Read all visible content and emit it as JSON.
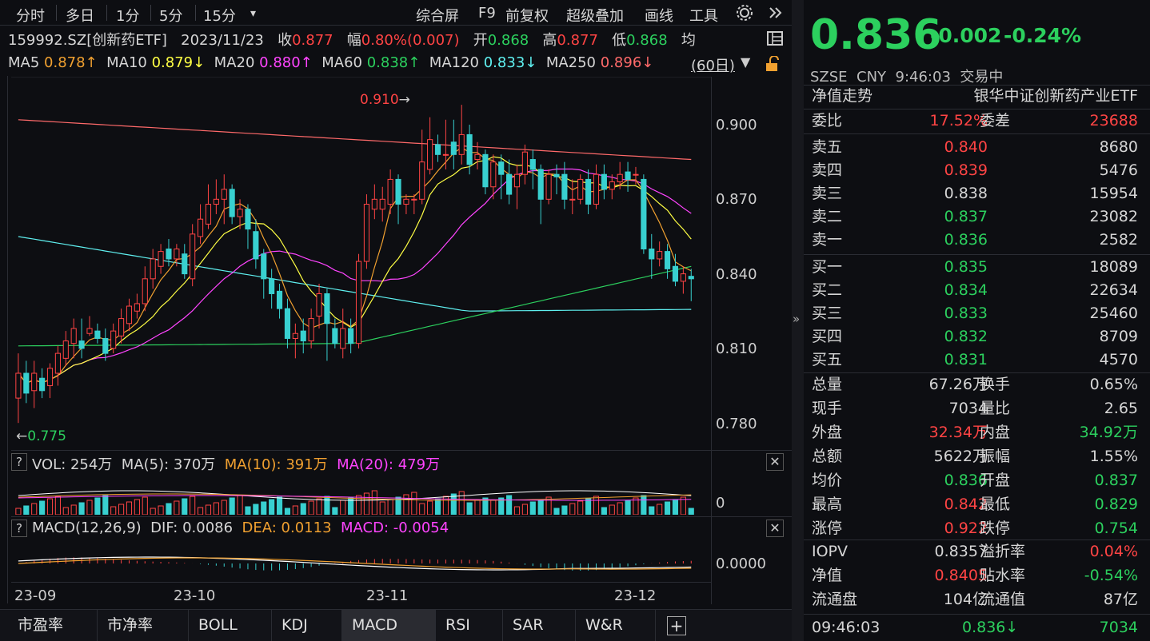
{
  "toolbar": {
    "left": [
      "分时",
      "多日",
      "1分",
      "5分",
      "15分"
    ],
    "dropdown": "▾",
    "right": [
      "综合屏",
      "F9",
      "前复权",
      "超级叠加",
      "画线",
      "工具"
    ]
  },
  "info": {
    "code": "159992.SZ[创新药ETF]",
    "date": "2023/11/23",
    "close_label": "收",
    "close": "0.877",
    "range_label": "幅",
    "range": "0.80%(0.007)",
    "open_label": "开",
    "open": "0.868",
    "high_label": "高",
    "high": "0.877",
    "low_label": "低",
    "low": "0.868",
    "avg_label": "均"
  },
  "ma": {
    "ma5_l": "MA5",
    "ma5": "0.878↑",
    "ma10_l": "MA10",
    "ma10": "0.879↓",
    "ma20_l": "MA20",
    "ma20": "0.880↑",
    "ma60_l": "MA60",
    "ma60": "0.838↑",
    "ma120_l": "MA120",
    "ma120": "0.833↓",
    "ma250_l": "MA250",
    "ma250": "0.896↓",
    "period": "(60日)"
  },
  "colors": {
    "up": "#ff4444",
    "down": "#2cd05e",
    "cyan": "#5ff0f0",
    "bg": "#0d0e12"
  },
  "axis": {
    "prices": [
      "0.900",
      "0.870",
      "0.840",
      "0.810",
      "0.780"
    ],
    "max_label": "0.910",
    "min_label": "0.775",
    "vol_zero": "0",
    "macd_zero": "0.0000",
    "dates": [
      "23-09",
      "23-10",
      "23-11",
      "23-12"
    ]
  },
  "vol": {
    "q": "?",
    "label": "VOL: 254万",
    "ma5": "MA(5): 370万",
    "ma10": "MA(10): 391万",
    "ma20": "MA(20): 479万"
  },
  "macd": {
    "q": "?",
    "label": "MACD(12,26,9)",
    "dif": "DIF: 0.0086",
    "dea": "DEA: 0.0113",
    "macd": "MACD: -0.0054"
  },
  "tabs": [
    "市盈率",
    "市净率",
    "BOLL",
    "KDJ",
    "MACD",
    "RSI",
    "SAR",
    "W&R"
  ],
  "quote": {
    "price": "0.836",
    "chg": "-0.002",
    "pct": "-0.24%",
    "market": "SZSE",
    "cur": "CNY",
    "time": "9:46:03",
    "status": "交易中",
    "nav_label": "净值走势",
    "name": "银华中证创新药产业ETF",
    "wb_l": "委比",
    "wb": "17.52%",
    "wc_l": "委差",
    "wc": "23688"
  },
  "asks": [
    {
      "l": "卖五",
      "p": "0.840",
      "v": "8680",
      "c": "red"
    },
    {
      "l": "卖四",
      "p": "0.839",
      "v": "5476",
      "c": "red"
    },
    {
      "l": "卖三",
      "p": "0.838",
      "v": "15954",
      "c": "w"
    },
    {
      "l": "卖二",
      "p": "0.837",
      "v": "23082",
      "c": "grn"
    },
    {
      "l": "卖一",
      "p": "0.836",
      "v": "2582",
      "c": "grn"
    }
  ],
  "bids": [
    {
      "l": "买一",
      "p": "0.835",
      "v": "18089",
      "c": "grn"
    },
    {
      "l": "买二",
      "p": "0.834",
      "v": "22634",
      "c": "grn"
    },
    {
      "l": "买三",
      "p": "0.833",
      "v": "25460",
      "c": "grn"
    },
    {
      "l": "买四",
      "p": "0.832",
      "v": "8709",
      "c": "grn"
    },
    {
      "l": "买五",
      "p": "0.831",
      "v": "4570",
      "c": "grn"
    }
  ],
  "stats": [
    {
      "k": "总量",
      "v": "67.26万",
      "vc": "w",
      "k2": "换手",
      "v2": "0.65%",
      "v2c": "w"
    },
    {
      "k": "现手",
      "v": "7034",
      "vc": "w",
      "k2": "量比",
      "v2": "2.65",
      "v2c": "w"
    },
    {
      "k": "外盘",
      "v": "32.34万",
      "vc": "red",
      "k2": "内盘",
      "v2": "34.92万",
      "v2c": "grn"
    },
    {
      "k": "总额",
      "v": "5622万",
      "vc": "w",
      "k2": "振幅",
      "v2": "1.55%",
      "v2c": "w"
    },
    {
      "k": "均价",
      "v": "0.836",
      "vc": "grn",
      "k2": "开盘",
      "v2": "0.837",
      "v2c": "grn"
    },
    {
      "k": "最高",
      "v": "0.842",
      "vc": "red",
      "k2": "最低",
      "v2": "0.829",
      "v2c": "grn"
    },
    {
      "k": "涨停",
      "v": "0.922",
      "vc": "red",
      "k2": "跌停",
      "v2": "0.754",
      "v2c": "grn"
    }
  ],
  "stats2": [
    {
      "k": "IOPV",
      "v": "0.8357",
      "vc": "w",
      "k2": "溢折率",
      "v2": "0.04%",
      "v2c": "red"
    },
    {
      "k": "净值",
      "v": "0.8405",
      "vc": "red",
      "k2": "贴水率",
      "v2": "-0.54%",
      "v2c": "grn"
    },
    {
      "k": "流通盘",
      "v": "104亿",
      "vc": "w",
      "k2": "流通值",
      "v2": "87亿",
      "v2c": "w"
    }
  ],
  "tick": {
    "time": "09:46:03",
    "price": "0.836",
    "arrow": "↓",
    "vol": "7034"
  },
  "candles": [
    [
      0.79,
      0.8,
      0.808,
      0.78
    ],
    [
      0.8,
      0.792,
      0.805,
      0.788
    ],
    [
      0.793,
      0.8,
      0.805,
      0.786
    ],
    [
      0.798,
      0.793,
      0.802,
      0.79
    ],
    [
      0.795,
      0.802,
      0.804,
      0.79
    ],
    [
      0.8,
      0.808,
      0.811,
      0.795
    ],
    [
      0.806,
      0.813,
      0.817,
      0.803
    ],
    [
      0.812,
      0.818,
      0.822,
      0.806
    ],
    [
      0.813,
      0.81,
      0.822,
      0.806
    ],
    [
      0.816,
      0.818,
      0.823,
      0.815
    ],
    [
      0.817,
      0.814,
      0.82,
      0.812
    ],
    [
      0.814,
      0.808,
      0.818,
      0.805
    ],
    [
      0.81,
      0.817,
      0.82,
      0.808
    ],
    [
      0.815,
      0.822,
      0.826,
      0.812
    ],
    [
      0.82,
      0.827,
      0.83,
      0.817
    ],
    [
      0.825,
      0.828,
      0.832,
      0.822
    ],
    [
      0.828,
      0.838,
      0.843,
      0.825
    ],
    [
      0.838,
      0.846,
      0.85,
      0.834
    ],
    [
      0.843,
      0.849,
      0.852,
      0.84
    ],
    [
      0.85,
      0.846,
      0.854,
      0.843
    ],
    [
      0.846,
      0.85,
      0.852,
      0.843
    ],
    [
      0.848,
      0.84,
      0.852,
      0.838
    ],
    [
      0.838,
      0.856,
      0.86,
      0.835
    ],
    [
      0.855,
      0.862,
      0.868,
      0.852
    ],
    [
      0.86,
      0.868,
      0.876,
      0.858
    ],
    [
      0.868,
      0.87,
      0.878,
      0.864
    ],
    [
      0.87,
      0.874,
      0.88,
      0.86
    ],
    [
      0.874,
      0.863,
      0.876,
      0.86
    ],
    [
      0.863,
      0.866,
      0.87,
      0.858
    ],
    [
      0.866,
      0.858,
      0.868,
      0.85
    ],
    [
      0.857,
      0.846,
      0.862,
      0.842
    ],
    [
      0.848,
      0.838,
      0.85,
      0.83
    ],
    [
      0.838,
      0.832,
      0.842,
      0.826
    ],
    [
      0.833,
      0.826,
      0.836,
      0.822
    ],
    [
      0.826,
      0.814,
      0.83,
      0.81
    ],
    [
      0.814,
      0.816,
      0.82,
      0.806
    ],
    [
      0.817,
      0.813,
      0.822,
      0.808
    ],
    [
      0.813,
      0.822,
      0.826,
      0.81
    ],
    [
      0.823,
      0.832,
      0.836,
      0.818
    ],
    [
      0.832,
      0.82,
      0.834,
      0.805
    ],
    [
      0.818,
      0.812,
      0.822,
      0.81
    ],
    [
      0.81,
      0.818,
      0.826,
      0.806
    ],
    [
      0.818,
      0.812,
      0.822,
      0.808
    ],
    [
      0.812,
      0.845,
      0.848,
      0.81
    ],
    [
      0.845,
      0.868,
      0.872,
      0.842
    ],
    [
      0.866,
      0.87,
      0.876,
      0.862
    ],
    [
      0.866,
      0.87,
      0.875,
      0.861
    ],
    [
      0.868,
      0.878,
      0.882,
      0.864
    ],
    [
      0.878,
      0.868,
      0.88,
      0.86
    ],
    [
      0.868,
      0.87,
      0.872,
      0.864
    ],
    [
      0.87,
      0.87,
      0.872,
      0.864
    ],
    [
      0.87,
      0.885,
      0.898,
      0.868
    ],
    [
      0.882,
      0.894,
      0.903,
      0.88
    ],
    [
      0.892,
      0.888,
      0.896,
      0.885
    ],
    [
      0.888,
      0.888,
      0.902,
      0.882
    ],
    [
      0.893,
      0.888,
      0.902,
      0.882
    ],
    [
      0.888,
      0.896,
      0.908,
      0.884
    ],
    [
      0.896,
      0.884,
      0.9,
      0.88
    ],
    [
      0.886,
      0.888,
      0.893,
      0.882
    ],
    [
      0.888,
      0.875,
      0.89,
      0.872
    ],
    [
      0.875,
      0.885,
      0.888,
      0.87
    ],
    [
      0.885,
      0.88,
      0.888,
      0.87
    ],
    [
      0.88,
      0.872,
      0.886,
      0.868
    ],
    [
      0.875,
      0.88,
      0.884,
      0.866
    ],
    [
      0.88,
      0.889,
      0.892,
      0.876
    ],
    [
      0.886,
      0.882,
      0.89,
      0.874
    ],
    [
      0.882,
      0.87,
      0.884,
      0.86
    ],
    [
      0.87,
      0.88,
      0.882,
      0.868
    ],
    [
      0.88,
      0.879,
      0.884,
      0.872
    ],
    [
      0.88,
      0.87,
      0.885,
      0.866
    ],
    [
      0.87,
      0.87,
      0.878,
      0.864
    ],
    [
      0.87,
      0.878,
      0.88,
      0.868
    ],
    [
      0.878,
      0.868,
      0.882,
      0.864
    ],
    [
      0.868,
      0.88,
      0.884,
      0.866
    ],
    [
      0.88,
      0.874,
      0.884,
      0.87
    ],
    [
      0.874,
      0.877,
      0.88,
      0.87
    ],
    [
      0.877,
      0.88,
      0.885,
      0.874
    ],
    [
      0.881,
      0.878,
      0.885,
      0.873
    ],
    [
      0.88,
      0.88,
      0.883,
      0.876
    ],
    [
      0.878,
      0.85,
      0.88,
      0.848
    ],
    [
      0.85,
      0.846,
      0.856,
      0.838
    ],
    [
      0.846,
      0.849,
      0.853,
      0.843
    ],
    [
      0.849,
      0.842,
      0.852,
      0.838
    ],
    [
      0.843,
      0.837,
      0.848,
      0.835
    ],
    [
      0.837,
      0.84,
      0.843,
      0.832
    ],
    [
      0.839,
      0.838,
      0.842,
      0.829
    ]
  ]
}
